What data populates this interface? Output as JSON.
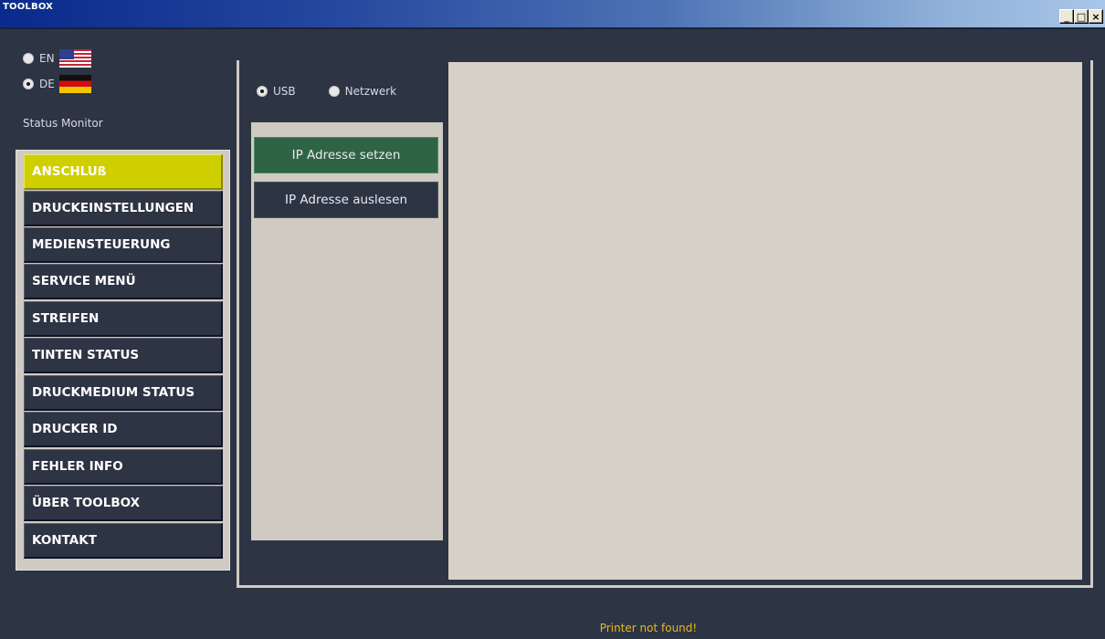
{
  "window": {
    "title": "TOOLBOX",
    "controls": {
      "minimize": "_",
      "maximize": "□",
      "close": "×"
    }
  },
  "language": {
    "options": [
      {
        "label": "EN",
        "flag": "us-flag-icon",
        "selected": false
      },
      {
        "label": "DE",
        "flag": "de-flag-icon",
        "selected": true
      }
    ]
  },
  "sidebar": {
    "status_label": "Status Monitor",
    "items": [
      {
        "label": "ANSCHLUß",
        "active": true
      },
      {
        "label": "DRUCKEINSTELLUNGEN",
        "active": false
      },
      {
        "label": "MEDIENSTEUERUNG",
        "active": false
      },
      {
        "label": "SERVICE MENÜ",
        "active": false
      },
      {
        "label": "STREIFEN",
        "active": false
      },
      {
        "label": "TINTEN STATUS",
        "active": false
      },
      {
        "label": "DRUCKMEDIUM STATUS",
        "active": false
      },
      {
        "label": "DRUCKER ID",
        "active": false
      },
      {
        "label": "FEHLER INFO",
        "active": false
      },
      {
        "label": "ÜBER TOOLBOX",
        "active": false
      },
      {
        "label": "KONTAKT",
        "active": false
      }
    ]
  },
  "connection": {
    "options": [
      {
        "label": "USB",
        "selected": true
      },
      {
        "label": "Netzwerk",
        "selected": false
      }
    ]
  },
  "actions": [
    {
      "label": "IP Adresse setzen",
      "active": true
    },
    {
      "label": "IP Adresse auslesen",
      "active": false
    }
  ],
  "status": {
    "message": "Printer not found!"
  },
  "colors": {
    "background": "#2d3443",
    "active_nav": "#cfcf00",
    "active_action": "#2e6444",
    "status_text": "#e8b820",
    "panel": "#cfcbc3"
  }
}
